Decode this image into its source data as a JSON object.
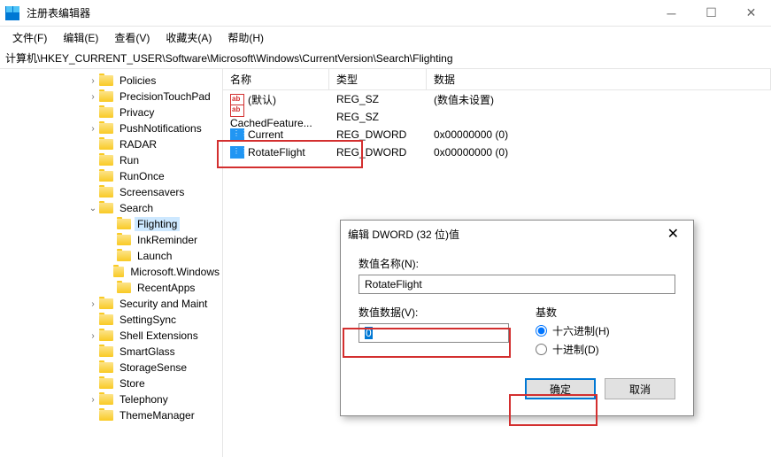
{
  "window": {
    "title": "注册表编辑器"
  },
  "menu": {
    "file": "文件(F)",
    "edit": "编辑(E)",
    "view": "查看(V)",
    "favorites": "收藏夹(A)",
    "help": "帮助(H)"
  },
  "address": "计算机\\HKEY_CURRENT_USER\\Software\\Microsoft\\Windows\\CurrentVersion\\Search\\Flighting",
  "tree": [
    {
      "indent": 98,
      "expand": ">",
      "label": "Policies"
    },
    {
      "indent": 98,
      "expand": ">",
      "label": "PrecisionTouchPad"
    },
    {
      "indent": 98,
      "expand": "",
      "label": "Privacy"
    },
    {
      "indent": 98,
      "expand": ">",
      "label": "PushNotifications"
    },
    {
      "indent": 98,
      "expand": "",
      "label": "RADAR"
    },
    {
      "indent": 98,
      "expand": "",
      "label": "Run"
    },
    {
      "indent": 98,
      "expand": "",
      "label": "RunOnce"
    },
    {
      "indent": 98,
      "expand": "",
      "label": "Screensavers"
    },
    {
      "indent": 98,
      "expand": "v",
      "label": "Search"
    },
    {
      "indent": 118,
      "expand": "",
      "label": "Flighting",
      "selected": true
    },
    {
      "indent": 118,
      "expand": "",
      "label": "InkReminder"
    },
    {
      "indent": 118,
      "expand": "",
      "label": "Launch"
    },
    {
      "indent": 118,
      "expand": "",
      "label": "Microsoft.Windows"
    },
    {
      "indent": 118,
      "expand": "",
      "label": "RecentApps"
    },
    {
      "indent": 98,
      "expand": ">",
      "label": "Security and Maint"
    },
    {
      "indent": 98,
      "expand": "",
      "label": "SettingSync"
    },
    {
      "indent": 98,
      "expand": ">",
      "label": "Shell Extensions"
    },
    {
      "indent": 98,
      "expand": "",
      "label": "SmartGlass"
    },
    {
      "indent": 98,
      "expand": "",
      "label": "StorageSense"
    },
    {
      "indent": 98,
      "expand": "",
      "label": "Store"
    },
    {
      "indent": 98,
      "expand": ">",
      "label": "Telephony"
    },
    {
      "indent": 98,
      "expand": "",
      "label": "ThemeManager"
    }
  ],
  "list_headers": {
    "name": "名称",
    "type": "类型",
    "data": "数据"
  },
  "list": [
    {
      "icon": "sz",
      "name": "(默认)",
      "type": "REG_SZ",
      "data": "(数值未设置)"
    },
    {
      "icon": "sz",
      "name": "CachedFeature...",
      "type": "REG_SZ",
      "data": ""
    },
    {
      "icon": "dw",
      "name": "Current",
      "type": "REG_DWORD",
      "data": "0x00000000 (0)"
    },
    {
      "icon": "dw",
      "name": "RotateFlight",
      "type": "REG_DWORD",
      "data": "0x00000000 (0)"
    }
  ],
  "dialog": {
    "title": "编辑 DWORD (32 位)值",
    "name_label": "数值名称(N):",
    "name_value": "RotateFlight",
    "data_label": "数值数据(V):",
    "data_value": "0",
    "base_label": "基数",
    "radio_hex": "十六进制(H)",
    "radio_dec": "十进制(D)",
    "ok": "确定",
    "cancel": "取消"
  }
}
